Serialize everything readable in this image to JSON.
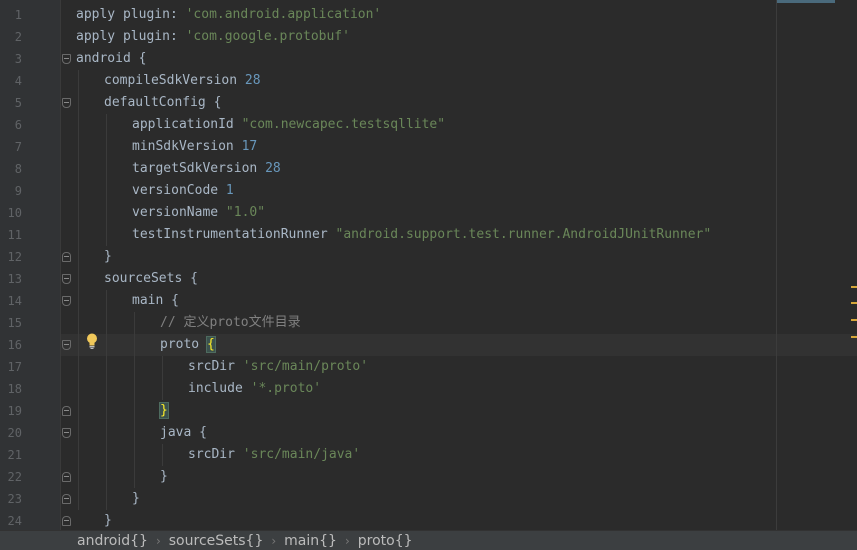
{
  "editor": {
    "lines": [
      {
        "num": "1",
        "indent": 0,
        "tokens": [
          {
            "t": "apply ",
            "c": ""
          },
          {
            "t": "plugin",
            "c": "id"
          },
          {
            "t": ": ",
            "c": ""
          },
          {
            "t": "'com.android.application'",
            "c": "str"
          }
        ]
      },
      {
        "num": "2",
        "indent": 0,
        "tokens": [
          {
            "t": "apply ",
            "c": ""
          },
          {
            "t": "plugin",
            "c": "id"
          },
          {
            "t": ": ",
            "c": ""
          },
          {
            "t": "'com.google.protobuf'",
            "c": "str"
          }
        ]
      },
      {
        "num": "3",
        "indent": 0,
        "tokens": [
          {
            "t": "android {",
            "c": ""
          }
        ]
      },
      {
        "num": "4",
        "indent": 1,
        "tokens": [
          {
            "t": "compileSdkVersion ",
            "c": ""
          },
          {
            "t": "28",
            "c": "num"
          }
        ]
      },
      {
        "num": "5",
        "indent": 1,
        "tokens": [
          {
            "t": "defaultConfig {",
            "c": ""
          }
        ]
      },
      {
        "num": "6",
        "indent": 2,
        "tokens": [
          {
            "t": "applicationId ",
            "c": ""
          },
          {
            "t": "\"com.newcapec.testsqllite\"",
            "c": "str"
          }
        ]
      },
      {
        "num": "7",
        "indent": 2,
        "tokens": [
          {
            "t": "minSdkVersion ",
            "c": ""
          },
          {
            "t": "17",
            "c": "num"
          }
        ]
      },
      {
        "num": "8",
        "indent": 2,
        "tokens": [
          {
            "t": "targetSdkVersion ",
            "c": ""
          },
          {
            "t": "28",
            "c": "num"
          }
        ]
      },
      {
        "num": "9",
        "indent": 2,
        "tokens": [
          {
            "t": "versionCode ",
            "c": ""
          },
          {
            "t": "1",
            "c": "num"
          }
        ]
      },
      {
        "num": "10",
        "indent": 2,
        "tokens": [
          {
            "t": "versionName ",
            "c": ""
          },
          {
            "t": "\"1.0\"",
            "c": "str"
          }
        ]
      },
      {
        "num": "11",
        "indent": 2,
        "tokens": [
          {
            "t": "testInstrumentationRunner ",
            "c": ""
          },
          {
            "t": "\"android.support.test.runner.AndroidJUnitRunner\"",
            "c": "str"
          }
        ]
      },
      {
        "num": "12",
        "indent": 1,
        "tokens": [
          {
            "t": "}",
            "c": ""
          }
        ]
      },
      {
        "num": "13",
        "indent": 1,
        "tokens": [
          {
            "t": "sourceSets {",
            "c": ""
          }
        ]
      },
      {
        "num": "14",
        "indent": 2,
        "tokens": [
          {
            "t": "main {",
            "c": ""
          }
        ]
      },
      {
        "num": "15",
        "indent": 3,
        "tokens": [
          {
            "t": "// 定义proto文件目录",
            "c": "comment"
          }
        ]
      },
      {
        "num": "16",
        "indent": 3,
        "tokens": [
          {
            "t": "proto ",
            "c": ""
          },
          {
            "t": "{",
            "c": "brace"
          }
        ]
      },
      {
        "num": "17",
        "indent": 4,
        "tokens": [
          {
            "t": "srcDir ",
            "c": ""
          },
          {
            "t": "'src/main/proto'",
            "c": "str"
          }
        ]
      },
      {
        "num": "18",
        "indent": 4,
        "tokens": [
          {
            "t": "include ",
            "c": ""
          },
          {
            "t": "'*.proto'",
            "c": "str"
          }
        ]
      },
      {
        "num": "19",
        "indent": 3,
        "tokens": [
          {
            "t": "}",
            "c": "brace"
          }
        ]
      },
      {
        "num": "20",
        "indent": 3,
        "tokens": [
          {
            "t": "java {",
            "c": ""
          }
        ]
      },
      {
        "num": "21",
        "indent": 4,
        "tokens": [
          {
            "t": "srcDir ",
            "c": ""
          },
          {
            "t": "'src/main/java'",
            "c": "str"
          }
        ]
      },
      {
        "num": "22",
        "indent": 3,
        "tokens": [
          {
            "t": "}",
            "c": ""
          }
        ]
      },
      {
        "num": "23",
        "indent": 2,
        "tokens": [
          {
            "t": "}",
            "c": ""
          }
        ]
      },
      {
        "num": "24",
        "indent": 1,
        "tokens": [
          {
            "t": "}",
            "c": ""
          }
        ]
      }
    ],
    "current_line": 16
  },
  "breadcrumb": [
    "android{}",
    "sourceSets{}",
    "main{}",
    "proto{}"
  ],
  "colors": {
    "string": "#6a8759",
    "number": "#6897bb",
    "comment": "#808080",
    "plain": "#a9b7c6",
    "brace_match": "#ffef28"
  },
  "icons": {
    "intention": "lightbulb-icon",
    "breadcrumb_separator": "chevron-right-icon"
  }
}
